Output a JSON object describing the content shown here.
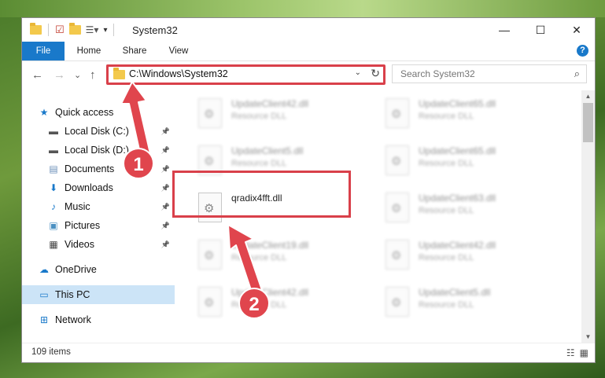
{
  "window": {
    "title": "System32"
  },
  "controls": {
    "minimize": "—",
    "maximize": "☐",
    "close": "✕"
  },
  "ribbon": {
    "tabs": [
      "File",
      "Home",
      "Share",
      "View"
    ],
    "help": "?"
  },
  "nav": {
    "back": "←",
    "forward": "→",
    "recent": "⌄",
    "up": "↑",
    "address": "C:\\Windows\\System32",
    "search_placeholder": "Search System32"
  },
  "sidebar": {
    "items": [
      {
        "label": "Quick access",
        "icon": "star-icon",
        "glyph": "★",
        "color": "#1979ca",
        "pinned": false
      },
      {
        "label": "Local Disk (C:)",
        "icon": "drive-icon",
        "glyph": "▬",
        "color": "#555555",
        "pinned": true
      },
      {
        "label": "Local Disk (D:)",
        "icon": "drive-icon",
        "glyph": "▬",
        "color": "#555555",
        "pinned": true
      },
      {
        "label": "Documents",
        "icon": "document-icon",
        "glyph": "▤",
        "color": "#6b8fb8",
        "pinned": true
      },
      {
        "label": "Downloads",
        "icon": "download-icon",
        "glyph": "⬇",
        "color": "#1979ca",
        "pinned": true
      },
      {
        "label": "Music",
        "icon": "music-icon",
        "glyph": "♪",
        "color": "#1979ca",
        "pinned": true
      },
      {
        "label": "Pictures",
        "icon": "picture-icon",
        "glyph": "▣",
        "color": "#4a90c2",
        "pinned": true
      },
      {
        "label": "Videos",
        "icon": "video-icon",
        "glyph": "▦",
        "color": "#444444",
        "pinned": true
      },
      {
        "label": "OneDrive",
        "icon": "cloud-icon",
        "glyph": "☁",
        "color": "#1979ca",
        "pinned": false
      },
      {
        "label": "This PC",
        "icon": "computer-icon",
        "glyph": "▭",
        "color": "#1979ca",
        "pinned": false,
        "selected": true
      },
      {
        "label": "Network",
        "icon": "network-icon",
        "glyph": "⊞",
        "color": "#1979ca",
        "pinned": false
      }
    ]
  },
  "files": [
    {
      "name": "UpdateClient42.dll",
      "type": "Resource DLL",
      "blur": true
    },
    {
      "name": "UpdateClient65.dll",
      "type": "Resource DLL",
      "blur": true
    },
    {
      "name": "UpdateClient5.dll",
      "type": "Resource DLL",
      "blur": true
    },
    {
      "name": "UpdateClient65.dll",
      "type": "Resource DLL",
      "blur": true
    },
    {
      "name": "qradix4fft.dll",
      "type": "",
      "blur": false
    },
    {
      "name": "UpdateClient63.dll",
      "type": "Resource DLL",
      "blur": true
    },
    {
      "name": "UpdateClient19.dll",
      "type": "Resource DLL",
      "blur": true
    },
    {
      "name": "UpdateClient42.dll",
      "type": "Resource DLL",
      "blur": true
    },
    {
      "name": "UpdateClient42.dll",
      "type": "Resource DLL",
      "blur": true
    },
    {
      "name": "UpdateClient5.dll",
      "type": "Resource DLL",
      "blur": true
    }
  ],
  "status": {
    "count": "109 items"
  },
  "callouts": {
    "step1": "1",
    "step2": "2",
    "color": "#e0454d"
  },
  "colors": {
    "accent": "#1979ca",
    "highlight": "#d9404a",
    "selected": "#cce4f7"
  }
}
